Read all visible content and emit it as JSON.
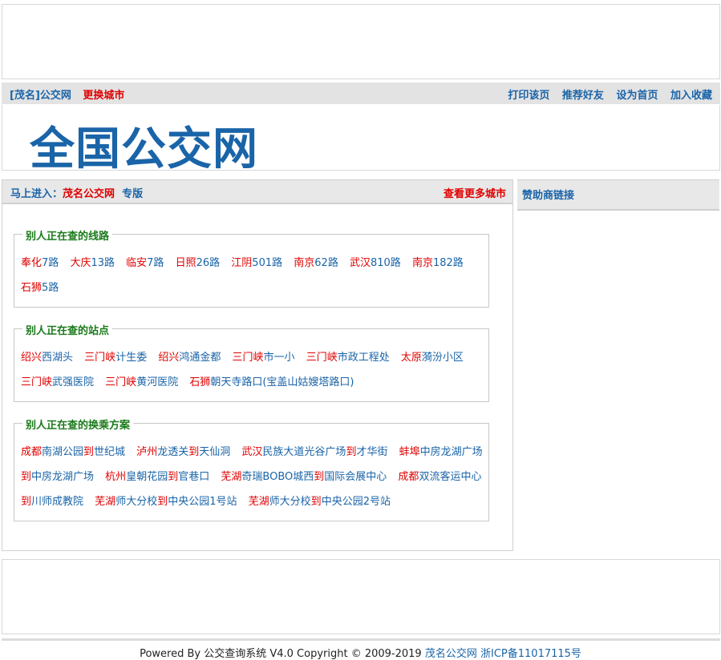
{
  "topbar": {
    "site_name": "[茂名]公交网",
    "change_city": "更换城市",
    "links": [
      "打印该页",
      "推荐好友",
      "设为首页",
      "加入收藏"
    ]
  },
  "logo": "全国公交网",
  "main": {
    "enter_prefix": "马上进入：",
    "enter_city": "茂名公交网",
    "enter_suffix": "专版",
    "more_cities": "查看更多城市"
  },
  "sections": {
    "lines": {
      "title": "别人正在查的线路",
      "items": [
        {
          "city": "奉化",
          "name": "7路"
        },
        {
          "city": "大庆",
          "name": "13路"
        },
        {
          "city": "临安",
          "name": "7路"
        },
        {
          "city": "日照",
          "name": "26路"
        },
        {
          "city": "江阴",
          "name": "501路"
        },
        {
          "city": "南京",
          "name": "62路"
        },
        {
          "city": "武汉",
          "name": "810路"
        },
        {
          "city": "南京",
          "name": "182路"
        },
        {
          "city": "石狮",
          "name": "5路"
        }
      ]
    },
    "stations": {
      "title": "别人正在查的站点",
      "items": [
        {
          "city": "绍兴",
          "name": "西湖头"
        },
        {
          "city": "三门峡",
          "name": "计生委"
        },
        {
          "city": "绍兴",
          "name": "鸿通金都"
        },
        {
          "city": "三门峡",
          "name": "市一小"
        },
        {
          "city": "三门峡",
          "name": "市政工程处"
        },
        {
          "city": "太原",
          "name": "漪汾小区"
        },
        {
          "city": "三门峡",
          "name": "武强医院"
        },
        {
          "city": "三门峡",
          "name": "黄河医院"
        },
        {
          "city": "石狮",
          "name": "朝天寺路口(宝盖山姑嫂塔路口)"
        }
      ]
    },
    "transfers": {
      "title": "别人正在查的换乘方案",
      "to_word": "到",
      "items": [
        {
          "city": "成都",
          "from": "南湖公园",
          "to": "世纪城"
        },
        {
          "city": "泸州",
          "from": "龙透关",
          "to": "天仙洞"
        },
        {
          "city": "武汉",
          "from": "民族大道光谷广场",
          "to": "才华街"
        },
        {
          "city": "蚌埠",
          "from": "中房龙湖广场",
          "to": "中房龙湖广场"
        },
        {
          "city": "杭州",
          "from": "皇朝花园",
          "to": "官巷口"
        },
        {
          "city": "芜湖",
          "from": "奇瑞BOBO城西",
          "to": "国际会展中心"
        },
        {
          "city": "成都",
          "from": "双流客运中心",
          "to": "川师成教院"
        },
        {
          "city": "芜湖",
          "from": "师大分校",
          "to": "中央公园1号站"
        },
        {
          "city": "芜湖",
          "from": "师大分校",
          "to": "中央公园2号站"
        }
      ]
    }
  },
  "sidebar": {
    "title": "赞助商链接"
  },
  "footer": {
    "text": "Powered By 公交查询系统 V4.0 Copyright © 2009-2019",
    "site_link": "茂名公交网",
    "icp": "浙ICP备11017115号"
  }
}
